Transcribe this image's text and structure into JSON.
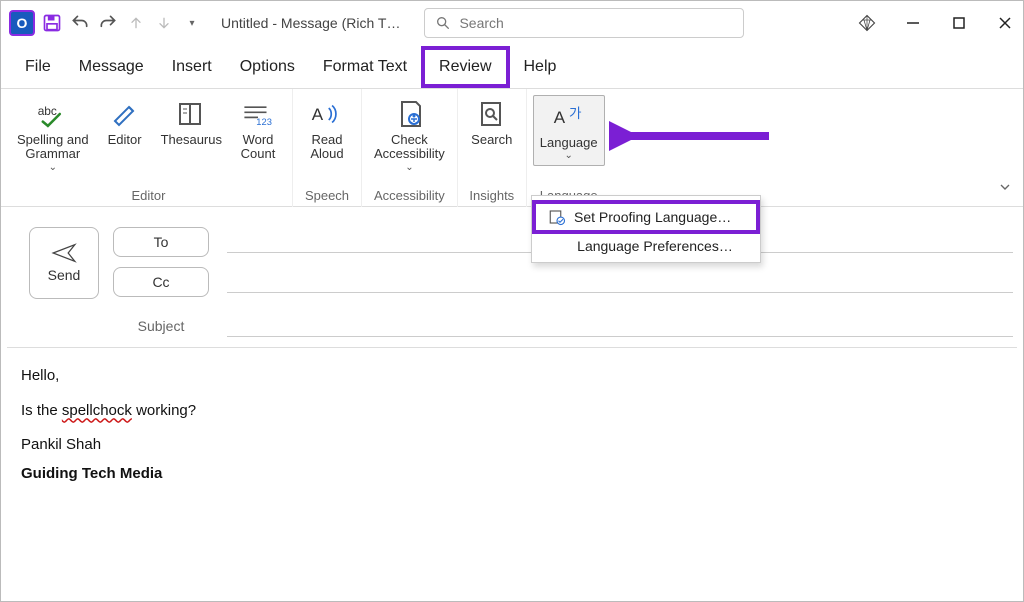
{
  "titlebar": {
    "app_glyph": "O",
    "doc_title": "Untitled  -  Message (Rich T…",
    "search_placeholder": "Search"
  },
  "tabs": {
    "file": "File",
    "message": "Message",
    "insert": "Insert",
    "options": "Options",
    "format_text": "Format Text",
    "review": "Review",
    "help": "Help",
    "active": "review"
  },
  "ribbon": {
    "spelling": "Spelling and\nGrammar",
    "editor": "Editor",
    "thesaurus": "Thesaurus",
    "word_count": "Word\nCount",
    "group_editor": "Editor",
    "read_aloud": "Read\nAloud",
    "group_speech": "Speech",
    "check_access": "Check\nAccessibility",
    "group_access": "Accessibility",
    "search": "Search",
    "group_insights": "Insights",
    "language": "Language",
    "group_language": "Language"
  },
  "lang_menu": {
    "set_proofing": "Set Proofing Language…",
    "lang_prefs": "Language Preferences…"
  },
  "compose": {
    "send": "Send",
    "to": "To",
    "cc": "Cc",
    "subject_label": "Subject",
    "to_value": "",
    "cc_value": "",
    "subject_value": ""
  },
  "body": {
    "greeting": "Hello,",
    "line1_prefix": "Is the ",
    "line1_misspelled": "spellchock",
    "line1_suffix": " working?",
    "sig_name": "Pankil Shah",
    "sig_org": "Guiding Tech Media"
  },
  "colors": {
    "highlight": "#7b1fd4"
  }
}
